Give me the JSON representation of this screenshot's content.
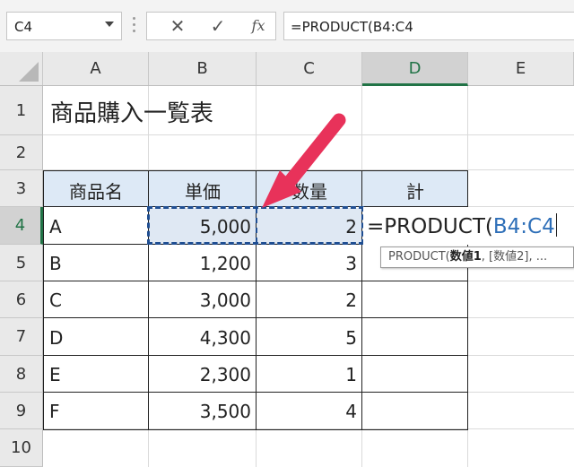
{
  "formula_bar": {
    "name_box": "C4",
    "cancel_icon": "✕",
    "enter_icon": "✓",
    "fx_label": "fx",
    "formula": "=PRODUCT(B4:C4"
  },
  "columns": [
    "A",
    "B",
    "C",
    "D",
    "E"
  ],
  "selected_column": "D",
  "rows": [
    "1",
    "2",
    "3",
    "4",
    "5",
    "6",
    "7",
    "8",
    "9",
    "10"
  ],
  "selected_row": "4",
  "sheet": {
    "title": "商品購入一覧表",
    "headers": [
      "商品名",
      "単価",
      "数量",
      "計"
    ],
    "data": [
      [
        "A",
        "5,000",
        "2"
      ],
      [
        "B",
        "1,200",
        "3"
      ],
      [
        "C",
        "3,000",
        "2"
      ],
      [
        "D",
        "4,300",
        "5"
      ],
      [
        "E",
        "2,300",
        "1"
      ],
      [
        "F",
        "3,500",
        "4"
      ]
    ]
  },
  "editing": {
    "prefix": "=PRODUCT(",
    "range_ref": "B4:C4"
  },
  "tooltip": {
    "fn": "PRODUCT(",
    "arg1": "数値1",
    "rest": ", [数値2], ..."
  },
  "colors": {
    "accent": "#217346",
    "header_fill": "#dde9f6",
    "arrow": "#e8325a",
    "range_ref": "#2e6fb8"
  }
}
